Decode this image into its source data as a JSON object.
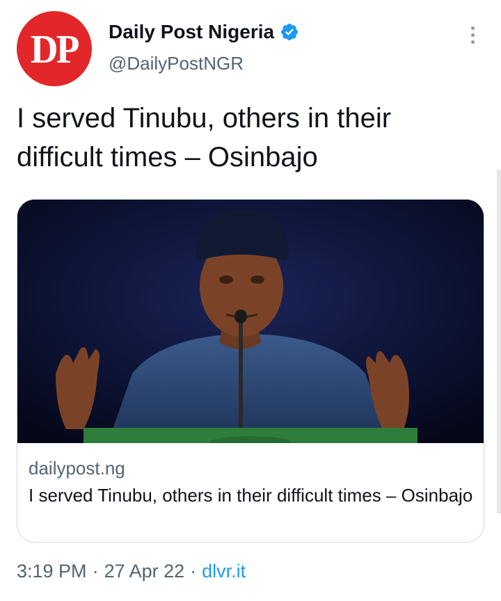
{
  "account": {
    "avatar_text": "DP",
    "display_name": "Daily Post Nigeria",
    "handle": "@DailyPostNGR",
    "verified": true
  },
  "tweet": {
    "text": "I served Tinubu, others in their difficult times – Osinbajo"
  },
  "card": {
    "domain": "dailypost.ng",
    "title": "I served Tinubu, others in their difficult times – Osinbajo",
    "image_alt": "Man in dark cap and traditional attire speaking at a podium microphone with raised hands"
  },
  "footer": {
    "time": "3:19 PM",
    "separator1": "·",
    "date": "27 Apr 22",
    "separator2": "·",
    "source": "dlvr.it"
  },
  "colors": {
    "avatar_bg": "#e2262a",
    "verified_blue": "#1d9bf0",
    "link_blue": "#1d9bf0",
    "secondary_text": "#536471"
  },
  "icons": [
    "verified-badge-icon",
    "more-options-icon"
  ]
}
